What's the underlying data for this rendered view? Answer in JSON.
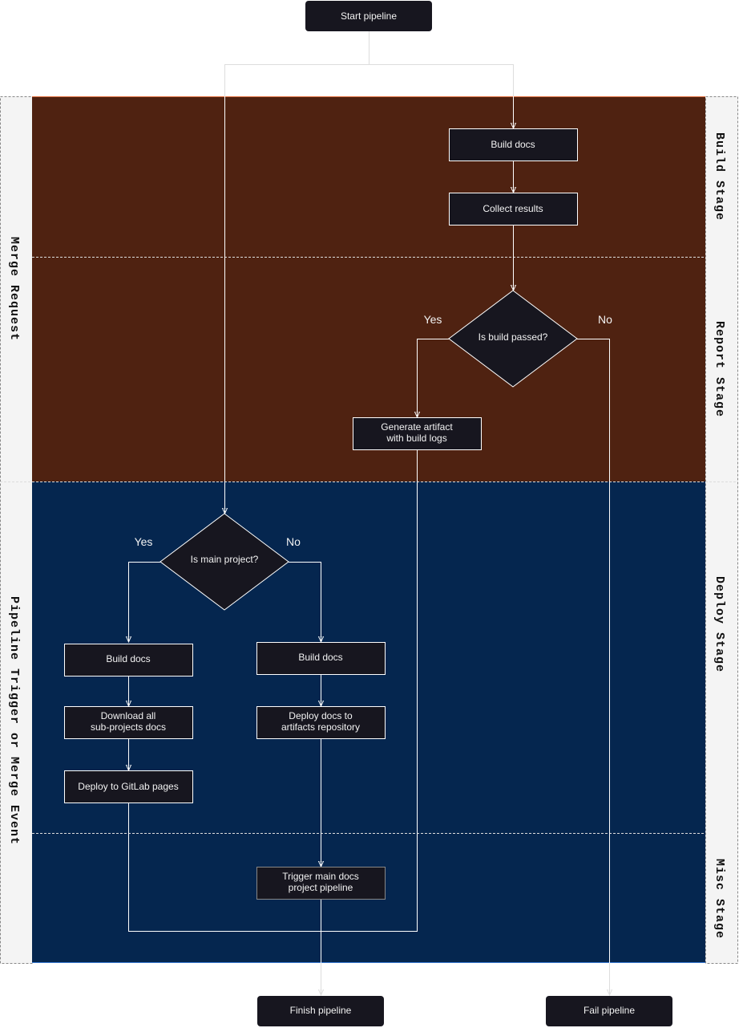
{
  "colors": {
    "build_report_band": "#4f2211",
    "deploy_misc_band": "#05264f",
    "node_fill": "#17161f",
    "lane_header": "#f4f4f4",
    "edge": "#ffffff"
  },
  "lanes": {
    "left": [
      "Merge Request",
      "Pipeline Trigger or Merge Event"
    ],
    "right": [
      "Build Stage",
      "Report Stage",
      "Deploy Stage",
      "Misc Stage"
    ]
  },
  "nodes": {
    "start": "Start pipeline",
    "build_docs": "Build docs",
    "collect_results": "Collect results",
    "is_build_passed": "Is build passed?",
    "generate_artifact": [
      "Generate artifact",
      "with build logs"
    ],
    "is_main_project": "Is main project?",
    "build_docs_main": "Build docs",
    "build_docs_sub": "Build docs",
    "download_all": [
      "Download all",
      "sub-projects docs"
    ],
    "deploy_artifacts": [
      "Deploy docs to",
      "artifacts repository"
    ],
    "deploy_gitlab": "Deploy to GitLab pages",
    "trigger_main": [
      "Trigger main docs",
      "project pipeline"
    ],
    "finish": "Finish pipeline",
    "fail": "Fail pipeline"
  },
  "edge_labels": {
    "build_yes": "Yes",
    "build_no": "No",
    "main_yes": "Yes",
    "main_no": "No"
  }
}
